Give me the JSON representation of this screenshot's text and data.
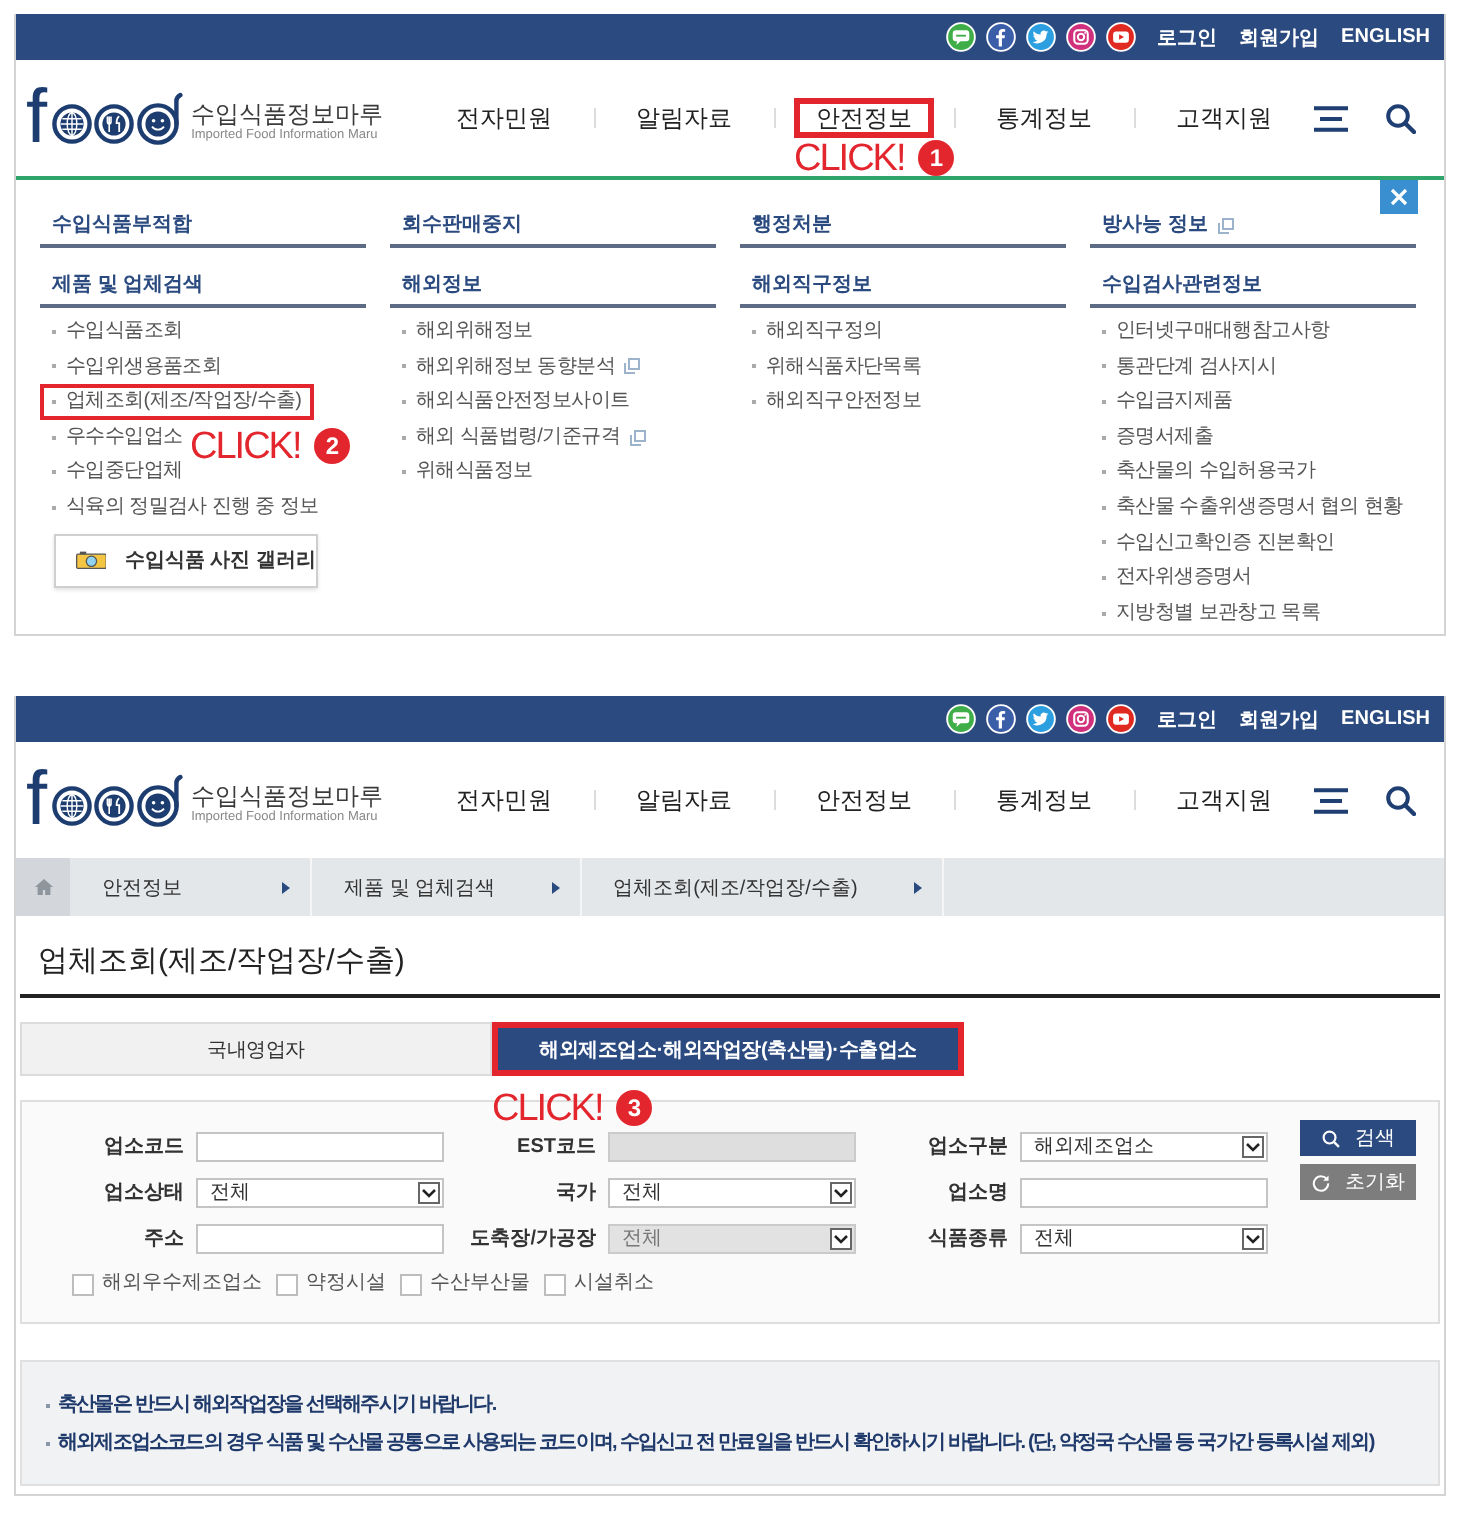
{
  "screens": [
    {
      "top_links": [
        "로그인",
        "회원가입",
        "ENGLISH"
      ],
      "logo": {
        "letter": "f",
        "title": "수입식품정보마루",
        "subtitle": "Imported Food Information Maru"
      },
      "nav": [
        {
          "label": "전자민원",
          "highlighted": false
        },
        {
          "label": "알림자료",
          "highlighted": false
        },
        {
          "label": "안전정보",
          "highlighted": true,
          "callout": {
            "text": "CLICK!",
            "step": "1"
          }
        },
        {
          "label": "통계정보",
          "highlighted": false
        },
        {
          "label": "고객지원",
          "highlighted": false
        }
      ],
      "mega_menu": {
        "top_links": [
          {
            "label": "수입식품부적합",
            "external": false
          },
          {
            "label": "회수판매중지",
            "external": false
          },
          {
            "label": "행정처분",
            "external": false
          },
          {
            "label": "방사능 정보",
            "external": true
          }
        ],
        "sections": [
          {
            "title": "제품 및 업체검색",
            "items": [
              {
                "label": "수입식품조회",
                "highlighted": false,
                "external": false
              },
              {
                "label": "수입위생용품조회",
                "highlighted": false,
                "external": false
              },
              {
                "label": "업체조회(제조/작업장/수출)",
                "highlighted": true,
                "external": false,
                "callout": {
                  "text": "CLICK!",
                  "step": "2"
                }
              },
              {
                "label": "우수수입업소",
                "highlighted": false,
                "external": false
              },
              {
                "label": "수입중단업체",
                "highlighted": false,
                "external": false
              },
              {
                "label": "식육의 정밀검사 진행 중 정보",
                "highlighted": false,
                "external": false
              }
            ],
            "button": "수입식품 사진 갤러리"
          },
          {
            "title": "해외정보",
            "items": [
              {
                "label": "해외위해정보",
                "highlighted": false,
                "external": false
              },
              {
                "label": "해외위해정보 동향분석",
                "highlighted": false,
                "external": true
              },
              {
                "label": "해외식품안전정보사이트",
                "highlighted": false,
                "external": false
              },
              {
                "label": "해외 식품법령/기준규격",
                "highlighted": false,
                "external": true
              },
              {
                "label": "위해식품정보",
                "highlighted": false,
                "external": false
              }
            ]
          },
          {
            "title": "해외직구정보",
            "items": [
              {
                "label": "해외직구정의",
                "highlighted": false,
                "external": false
              },
              {
                "label": "위해식품차단목록",
                "highlighted": false,
                "external": false
              },
              {
                "label": "해외직구안전정보",
                "highlighted": false,
                "external": false
              }
            ]
          },
          {
            "title": "수입검사관련정보",
            "items": [
              {
                "label": "인터넷구매대행참고사항",
                "highlighted": false,
                "external": false
              },
              {
                "label": "통관단계 검사지시",
                "highlighted": false,
                "external": false
              },
              {
                "label": "수입금지제품",
                "highlighted": false,
                "external": false
              },
              {
                "label": "증명서제출",
                "highlighted": false,
                "external": false
              },
              {
                "label": "축산물의 수입허용국가",
                "highlighted": false,
                "external": false
              },
              {
                "label": "축산물 수출위생증명서 협의 현황",
                "highlighted": false,
                "external": false
              },
              {
                "label": "수입신고확인증 진본확인",
                "highlighted": false,
                "external": false
              },
              {
                "label": "전자위생증명서",
                "highlighted": false,
                "external": false
              },
              {
                "label": "지방청별 보관창고 목록",
                "highlighted": false,
                "external": false
              }
            ]
          }
        ]
      }
    },
    {
      "top_links": [
        "로그인",
        "회원가입",
        "ENGLISH"
      ],
      "logo": {
        "letter": "f",
        "title": "수입식품정보마루",
        "subtitle": "Imported Food Information Maru"
      },
      "nav": [
        {
          "label": "전자민원",
          "highlighted": false
        },
        {
          "label": "알림자료",
          "highlighted": false
        },
        {
          "label": "안전정보",
          "highlighted": false
        },
        {
          "label": "통계정보",
          "highlighted": false
        },
        {
          "label": "고객지원",
          "highlighted": false
        }
      ],
      "breadcrumb": [
        "안전정보",
        "제품 및 업체검색",
        "업체조회(제조/작업장/수출)"
      ],
      "page_title": "업체조회(제조/작업장/수출)",
      "tabs": [
        {
          "label": "국내영업자",
          "selected": false,
          "highlighted": false
        },
        {
          "label": "해외제조업소·해외작업장(축산물)·수출업소",
          "selected": true,
          "highlighted": true,
          "callout": {
            "text": "CLICK!",
            "step": "3"
          }
        }
      ],
      "search_form": {
        "fields": [
          {
            "label": "업소코드",
            "kind": "input",
            "disabled": false
          },
          {
            "label": "EST코드",
            "kind": "input",
            "disabled": true
          },
          {
            "label": "업소구분",
            "kind": "select",
            "value": "해외제조업소",
            "disabled": false
          },
          {
            "label": "업소상태",
            "kind": "select",
            "value": "전체",
            "disabled": false
          },
          {
            "label": "국가",
            "kind": "select",
            "value": "전체",
            "disabled": false
          },
          {
            "label": "업소명",
            "kind": "input",
            "disabled": false
          },
          {
            "label": "주소",
            "kind": "input",
            "disabled": false
          },
          {
            "label": "도축장/가공장",
            "kind": "select",
            "value": "전체",
            "disabled": true
          },
          {
            "label": "식품종류",
            "kind": "select",
            "value": "전체",
            "disabled": false
          }
        ],
        "checkboxes": [
          {
            "label": "해외우수제조업소",
            "checked": false
          },
          {
            "label": "약정시설",
            "checked": false
          },
          {
            "label": "수산부산물",
            "checked": false
          },
          {
            "label": "시설취소",
            "checked": false
          }
        ],
        "buttons": [
          {
            "label": "검색",
            "kind": "search"
          },
          {
            "label": "초기화",
            "kind": "reset"
          }
        ]
      },
      "notes": [
        "축산물은 반드시 해외작업장을 선택해주시기 바랍니다.",
        "해외제조업소코드의 경우 식품 및 수산물 공통으로 사용되는 코드이며, 수입신고 전 만료일을 반드시 확인하시기 바랍니다. (단, 약정국 수산물 등 국가간 등록시설 제외)"
      ]
    }
  ]
}
